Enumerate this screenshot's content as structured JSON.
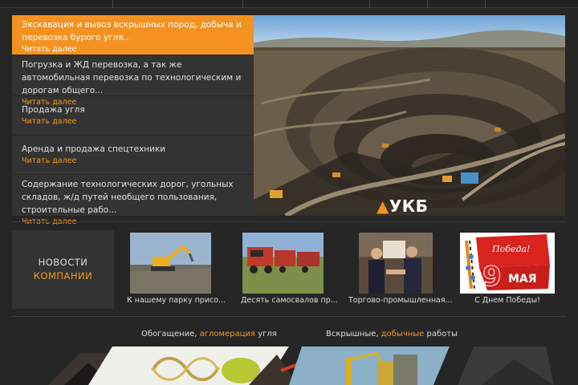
{
  "news": [
    {
      "title": "Экскавация и вывоз вскрышных пород, добыча и перевозка бурого угля...",
      "more": "Читать далее",
      "active": true
    },
    {
      "title": "Погрузка и ЖД перевозка, а так же автомобильная перевозка по технологическим и дорогам общего...",
      "more": "Читать далее",
      "active": false
    },
    {
      "title": "Продажа угля",
      "more": "Читать далее",
      "active": false
    },
    {
      "title": "Аренда и продажа спецтехники",
      "more": "Читать далее",
      "active": false
    },
    {
      "title": "Содержание технологических дорог, угольных складов, ж/д путей необщего пользования, строительные рабо...",
      "more": "Читать далее",
      "active": false
    }
  ],
  "hero": {
    "logo_text": "УКБ"
  },
  "company_news": {
    "line1": "НОВОСТИ",
    "line2": "КОМПАНИИ"
  },
  "thumbs": [
    {
      "caption": "К нашему парку присо..."
    },
    {
      "caption": "Десять самосвалов пр..."
    },
    {
      "caption": "Торгово-промышленная..."
    },
    {
      "caption": "С Днем Победы!",
      "poster_top": "Победа!",
      "poster_day": "9",
      "poster_month": "МАЯ"
    }
  ],
  "sections": [
    {
      "pre": "Обогащение, ",
      "hl": "агломерация",
      "post": " угля"
    },
    {
      "pre": "Вскрышные, ",
      "hl": "добычные",
      "post": " работы"
    }
  ],
  "colors": {
    "accent": "#f39221",
    "background": "#262626",
    "panel": "#333333"
  }
}
